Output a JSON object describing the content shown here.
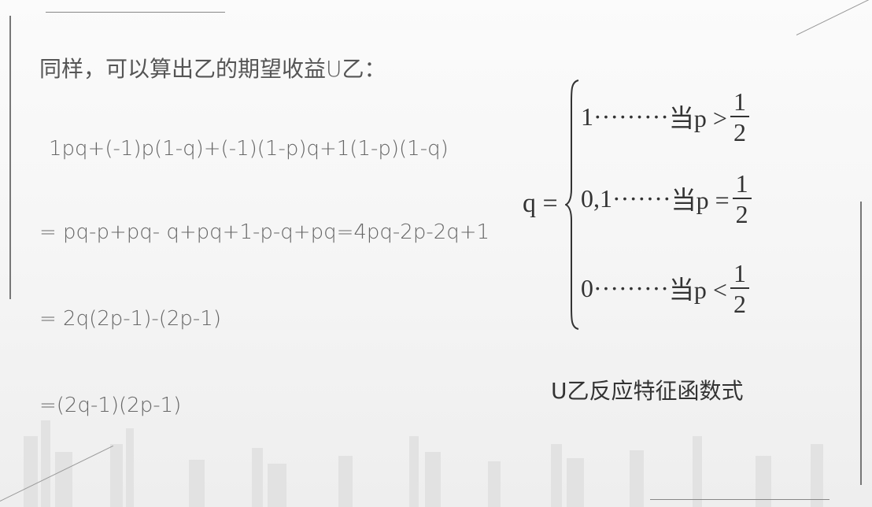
{
  "heading": "同样，可以算出乙的期望收益U乙：",
  "steps": [
    "1pq+(-1)p(1-q)+(-1)(1-p)q+1(1-p)(1-q)",
    "= pq-p+pq- q+pq+1-p-q+pq=4pq-2p-2q+1",
    "= 2q(2p-1)-(2p-1)",
    "=(2q-1)(2p-1)"
  ],
  "piecewise": {
    "lhs": "q =",
    "cases": [
      {
        "value": "1",
        "dots": "·········",
        "cond": "当p >",
        "num": "1",
        "den": "2"
      },
      {
        "value": "0,1",
        "dots": "·······",
        "cond": "当p =",
        "num": "1",
        "den": "2"
      },
      {
        "value": "0",
        "dots": "·········",
        "cond": "当p <",
        "num": "1",
        "den": "2"
      }
    ]
  },
  "caption": "U乙反应特征函数式"
}
